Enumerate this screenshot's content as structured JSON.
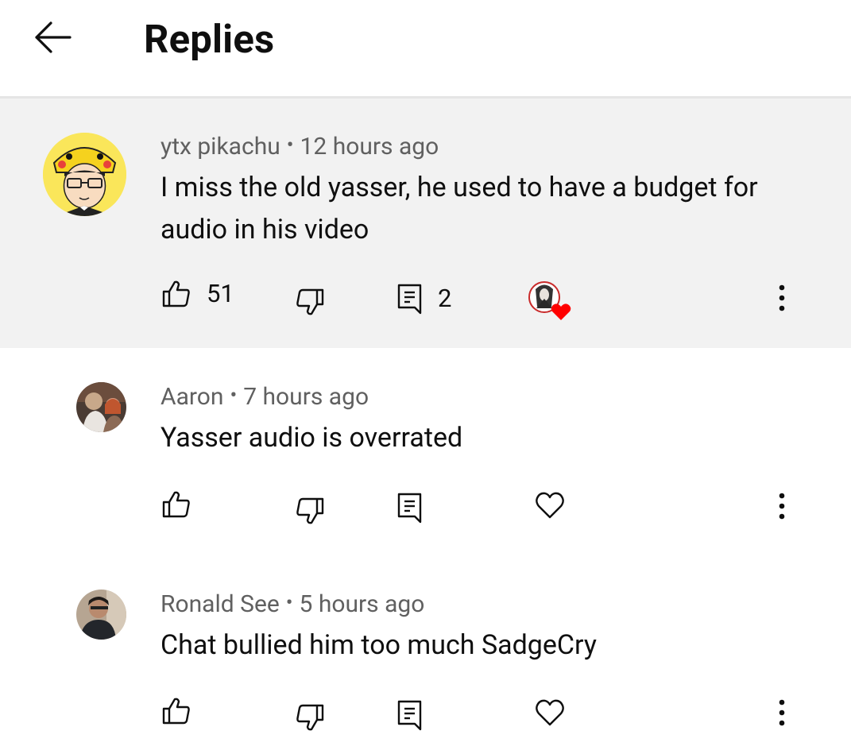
{
  "header": {
    "title": "Replies",
    "back_icon": "arrow-left-icon"
  },
  "comments": [
    {
      "author": "ytx pikachu",
      "time": "12 hours ago",
      "text": "I miss the old yasser, he used to have a budget for audio in his video",
      "likes": "51",
      "replies": "2",
      "creator_heart": true,
      "highlighted": true
    },
    {
      "author": "Aaron",
      "time": "7 hours ago",
      "text": "Yasser audio is overrated",
      "likes": "",
      "replies": "",
      "creator_heart": false,
      "highlighted": false
    },
    {
      "author": "Ronald See",
      "time": "5 hours ago",
      "text": "Chat bullied him too much SadgeCry",
      "likes": "",
      "replies": "",
      "creator_heart": false,
      "highlighted": false
    }
  ],
  "separator": "•",
  "colors": {
    "highlight_bg": "#f2f2f2",
    "meta_text": "#606060",
    "heart_red": "#ff0000"
  }
}
